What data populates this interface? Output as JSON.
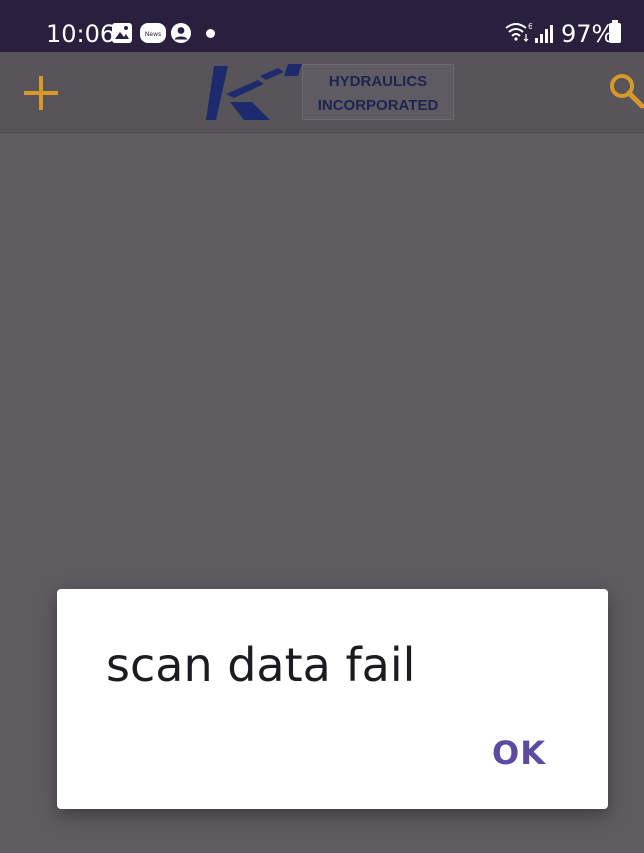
{
  "status_bar": {
    "time": "10:06",
    "icons": [
      "gallery-icon",
      "news-icon",
      "account-icon",
      "notification-dot-icon",
      "wifi-icon",
      "signal-icon",
      "battery-icon"
    ],
    "news_icon_label": "News",
    "battery_percent": "97%"
  },
  "app_bar": {
    "add_icon": "plus-icon",
    "search_icon": "search-icon",
    "logo": {
      "mark": "KT",
      "line1": "HYDRAULICS",
      "line2": "INCORPORATED"
    },
    "accent_color": "#e0a020"
  },
  "dialog": {
    "message": "scan data fail",
    "ok_label": "OK",
    "button_color": "#5d4ba3"
  },
  "colors": {
    "status_bar_bg": "#2a1f3d",
    "scrim": "#5f5b61",
    "logo_navy": "#1e2450"
  }
}
